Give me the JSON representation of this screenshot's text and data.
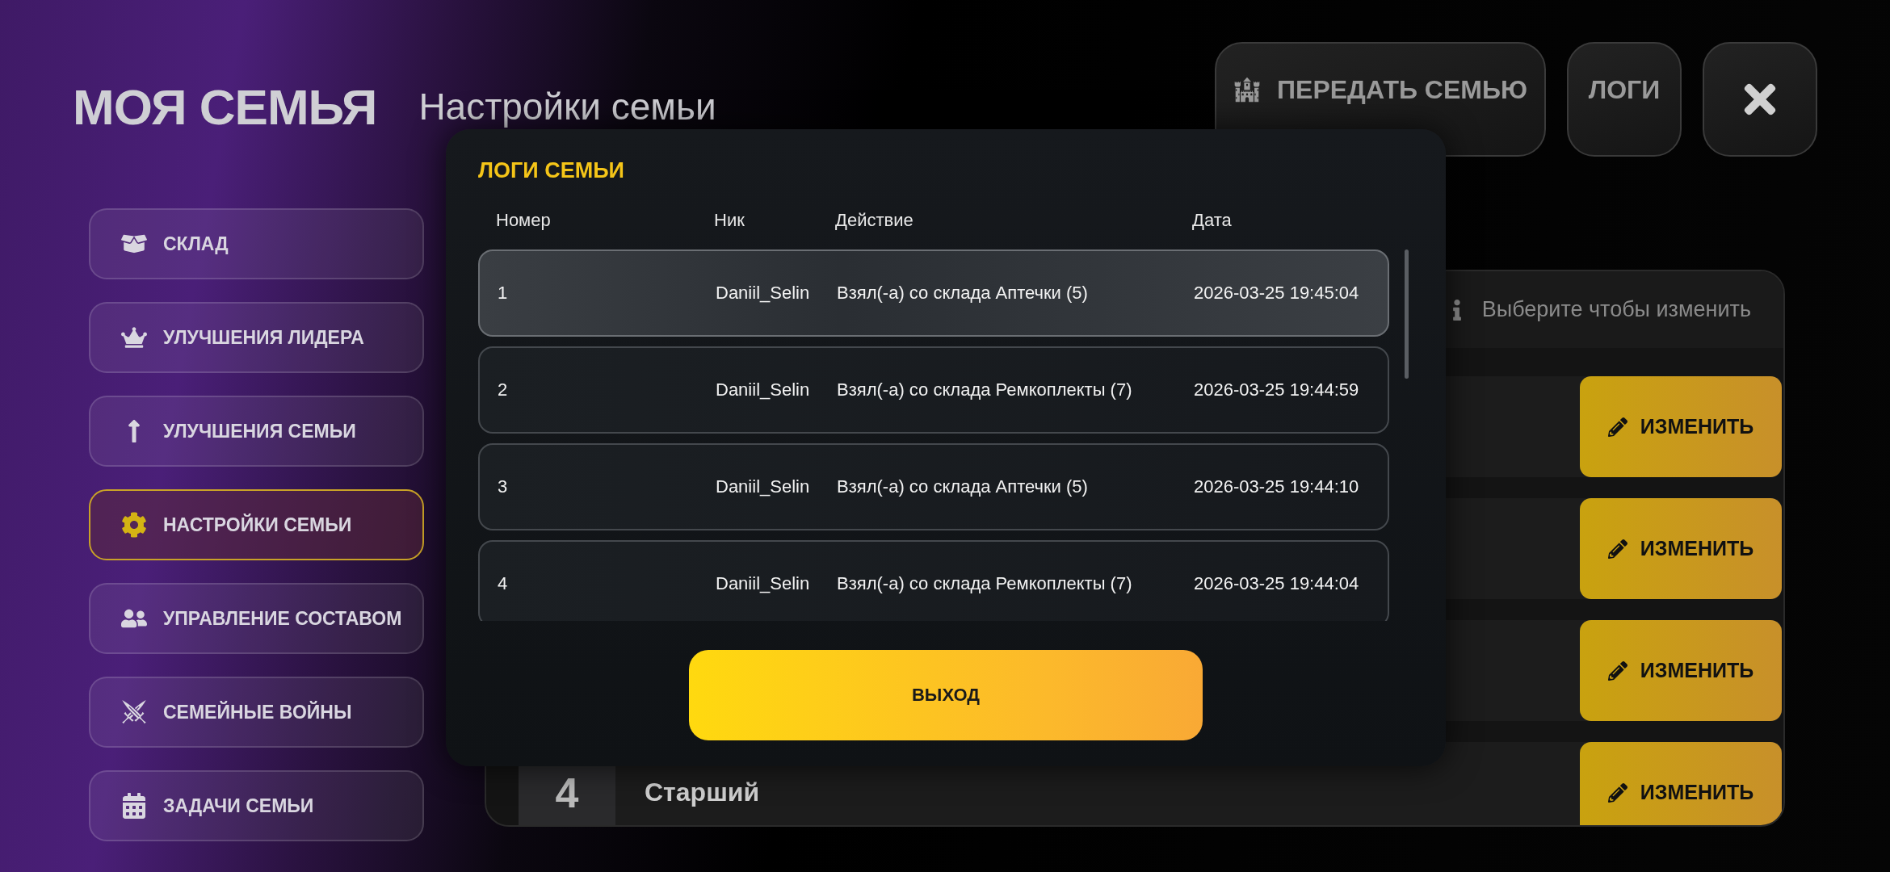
{
  "header": {
    "title": "МОЯ СЕМЬЯ",
    "subtitle": "Настройки семьи"
  },
  "top_buttons": [
    {
      "kind": "transfer",
      "label": "ПЕРЕДАТЬ СЕМЬЮ"
    },
    {
      "kind": "logs",
      "label": "ЛОГИ"
    },
    {
      "kind": "close"
    }
  ],
  "sidebar": {
    "items": [
      {
        "kind": "storage",
        "label": "СКЛАД",
        "selected": false
      },
      {
        "kind": "leader",
        "label": "УЛУЧШЕНИЯ ЛИДЕРА",
        "selected": false
      },
      {
        "kind": "upgrade",
        "label": "УЛУЧШЕНИЯ СЕМЬИ",
        "selected": false
      },
      {
        "kind": "settings",
        "label": "НАСТРОЙКИ СЕМЬИ",
        "selected": true
      },
      {
        "kind": "members",
        "label": "УПРАВЛЕНИЕ СОСТАВОМ",
        "selected": false
      },
      {
        "kind": "wars",
        "label": "СЕМЕЙНЫЕ ВОЙНЫ",
        "selected": false
      },
      {
        "kind": "tasks",
        "label": "ЗАДАЧИ СЕМЬИ",
        "selected": false
      }
    ]
  },
  "ranks_panel": {
    "hint": "Выберите чтобы изменить",
    "rows": [
      {
        "button": "ИЗМЕНИТЬ"
      },
      {
        "button": "ИЗМЕНИТЬ"
      },
      {
        "button": "ИЗМЕНИТЬ"
      },
      {
        "number": "4",
        "name": "Старший",
        "button": "ИЗМЕНИТЬ"
      }
    ]
  },
  "logs_modal": {
    "title": "ЛОГИ СЕМЬИ",
    "columns": [
      "Номер",
      "Ник",
      "Действие",
      "Дата"
    ],
    "rows": [
      {
        "selected": true,
        "cells": [
          "1",
          "Daniil_Selin",
          "Взял(-а) со склада Аптечки (5)",
          "2026-03-25 19:45:04"
        ]
      },
      {
        "selected": false,
        "cells": [
          "2",
          "Daniil_Selin",
          "Взял(-а) со склада Ремкоплекты (7)",
          "2026-03-25 19:44:59"
        ]
      },
      {
        "selected": false,
        "cells": [
          "3",
          "Daniil_Selin",
          "Взял(-а) со склада Аптечки (5)",
          "2026-03-25 19:44:10"
        ]
      },
      {
        "selected": false,
        "cells": [
          "4",
          "Daniil_Selin",
          "Взял(-а) со склада Ремкоплекты (7)",
          "2026-03-25 19:44:04"
        ]
      }
    ],
    "exit_button": "ВЫХОД"
  }
}
